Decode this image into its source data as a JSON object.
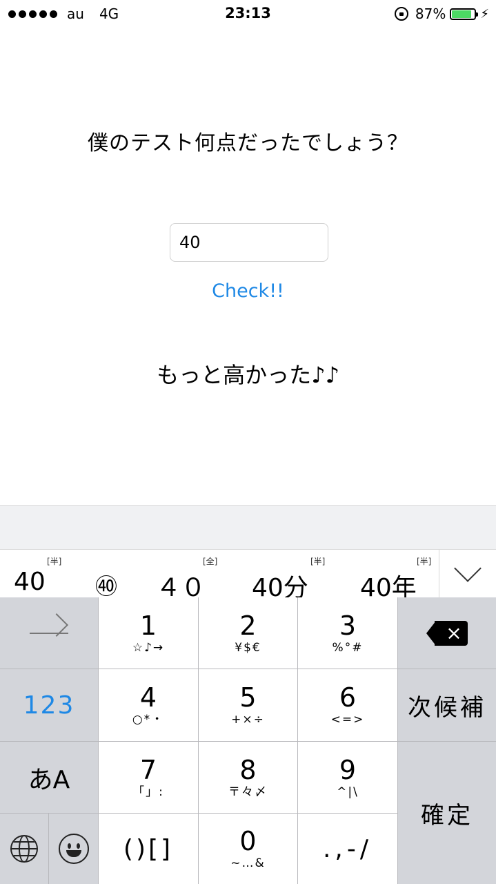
{
  "status_bar": {
    "carrier": "au",
    "network": "4G",
    "time": "23:13",
    "battery_percent": "87%",
    "battery_level": 0.87,
    "battery_color": "#4cd964",
    "icons": [
      "signal-dots-icon",
      "rotation-lock-icon",
      "battery-icon",
      "charging-bolt-icon"
    ]
  },
  "main": {
    "question": "僕のテスト何点だったでしょう？",
    "answer_value": "40",
    "check_label": "Check!!",
    "result": "もっと高かった♪♪",
    "accent_color": "#1e88e5"
  },
  "keyboard": {
    "candidates": [
      {
        "text": "40",
        "tag": "[半]"
      },
      {
        "text": "㊵",
        "tag": ""
      },
      {
        "text": "４０",
        "tag": "[全]"
      },
      {
        "text": "40分",
        "tag": "[半]"
      },
      {
        "text": "40年",
        "tag": "[半]"
      }
    ],
    "keys": {
      "k1": {
        "main": "1",
        "sub": "☆♪→"
      },
      "k2": {
        "main": "2",
        "sub": "¥$€"
      },
      "k3": {
        "main": "3",
        "sub": "%°#"
      },
      "k4": {
        "main": "4",
        "sub": "○*・"
      },
      "k5": {
        "main": "5",
        "sub": "+×÷"
      },
      "k6": {
        "main": "6",
        "sub": "<=>"
      },
      "k7": {
        "main": "7",
        "sub": "「」:"
      },
      "k8": {
        "main": "8",
        "sub": "〒々〆"
      },
      "k9": {
        "main": "9",
        "sub": "^|\\"
      },
      "k0": {
        "main": "0",
        "sub": "~…&"
      },
      "paren": "()[]",
      "punct": ".,-/"
    },
    "mode_123": "123",
    "mode_kana": "あA",
    "next_candidate": "次候補",
    "confirm": "確定"
  }
}
